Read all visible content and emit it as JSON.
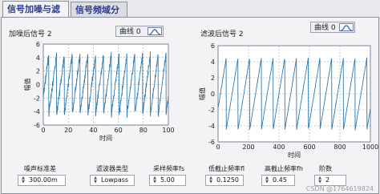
{
  "tabs": [
    {
      "label": "信号加噪与滤波"
    },
    {
      "label": "信号频域分析"
    }
  ],
  "plots": [
    {
      "title": "加噪后信号 2",
      "legend": "曲线 0",
      "ylabel": "幅值",
      "xlabel": "时间",
      "x_ticks": [
        "0",
        "20",
        "40",
        "60",
        "80",
        "100"
      ],
      "y_ticks": [
        "6",
        "4",
        "2",
        "0",
        "-2",
        "-4",
        "-6"
      ]
    },
    {
      "title": "滤波后信号 2",
      "legend": "曲线 0",
      "ylabel": "幅值",
      "xlabel": "时间",
      "x_ticks": [
        "0",
        "200",
        "400",
        "600",
        "800",
        "1000"
      ],
      "y_ticks": [
        "6",
        "4",
        "2",
        "0",
        "-2",
        "-4",
        "-6"
      ]
    }
  ],
  "controls": [
    {
      "label": "噪声标准差",
      "value": "300.00m"
    },
    {
      "label": "滤波器类型",
      "value": "Lowpass"
    },
    {
      "label": "采样频率fs",
      "value": "5.00"
    },
    {
      "label": "低截止频率fl",
      "value": "0.1250"
    },
    {
      "label": "高截止频率fh",
      "value": "0.45"
    },
    {
      "label": "阶数",
      "value": "2"
    }
  ],
  "watermark": "CSDN @1764619824",
  "colors": {
    "trace": "#2f7ab0",
    "grid": "#9aa3b2",
    "plot_bg": "#ffffff"
  },
  "chart_data": [
    {
      "type": "line",
      "title": "加噪后信号 2",
      "xlabel": "时间",
      "ylabel": "幅值",
      "xlim": [
        0,
        100
      ],
      "ylim": [
        -6,
        6
      ],
      "grid": true,
      "series": [
        {
          "name": "曲线 0",
          "shape": "sawtooth",
          "amplitude": 4.5,
          "cycles": 16,
          "noise_std": 0.3
        }
      ]
    },
    {
      "type": "line",
      "title": "滤波后信号 2",
      "xlabel": "时间",
      "ylabel": "幅值",
      "xlim": [
        0,
        1000
      ],
      "ylim": [
        -6,
        6
      ],
      "grid": true,
      "series": [
        {
          "name": "曲线 0",
          "shape": "sawtooth",
          "amplitude": 4.5,
          "cycles": 13,
          "noise_std": 0.05
        }
      ]
    }
  ]
}
